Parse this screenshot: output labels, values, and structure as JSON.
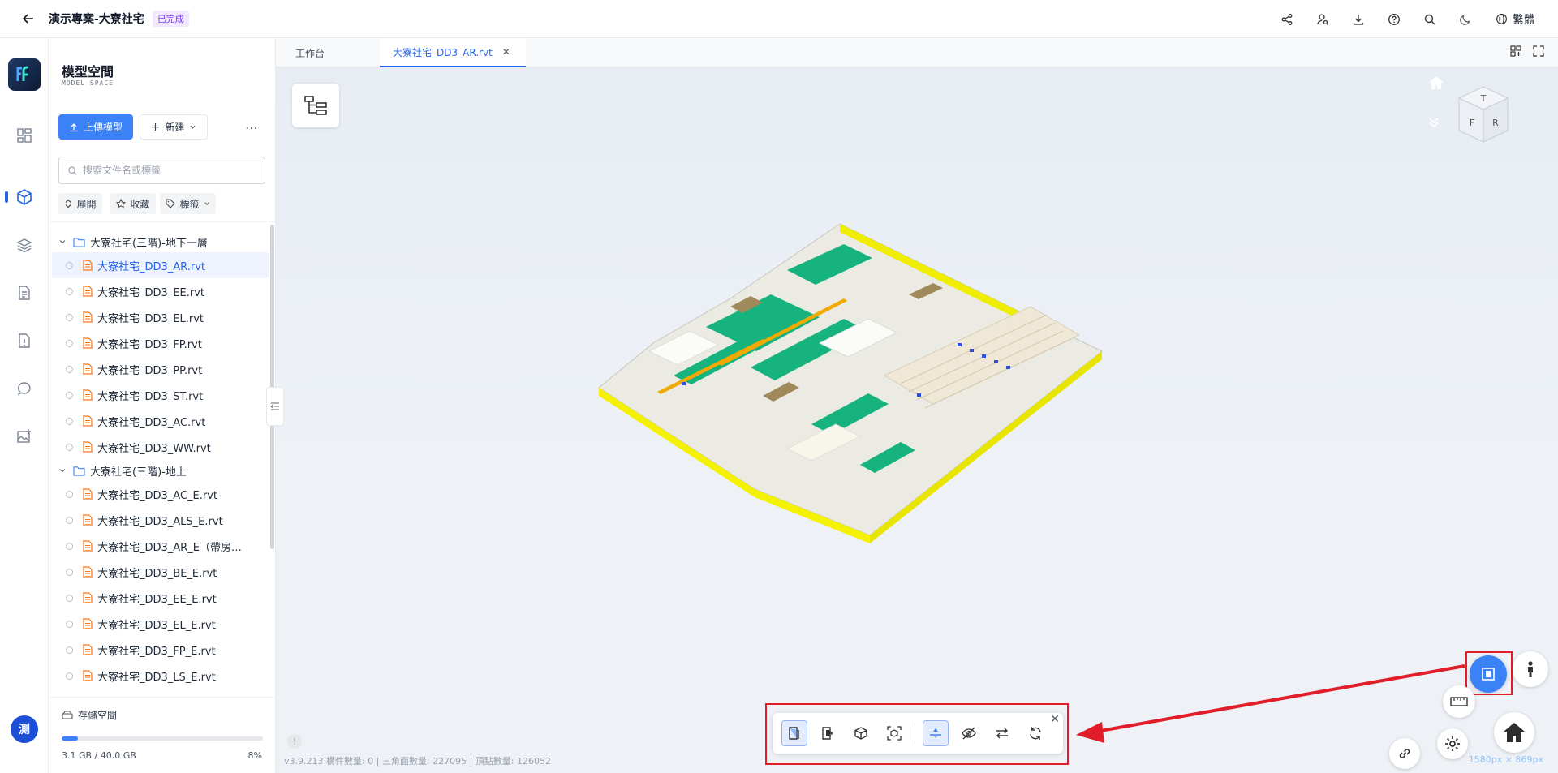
{
  "header": {
    "project_title": "演示專案-大寮社宅",
    "status": "已完成",
    "language": "繁體"
  },
  "sidebar": {
    "title": "模型空間",
    "subtitle": "MODEL SPACE",
    "upload_label": "上傳模型",
    "new_label": "新建",
    "search_placeholder": "搜索文件名或標籤",
    "filters": {
      "expand": "展開",
      "favorite": "收藏",
      "tag": "標籤"
    },
    "folders": [
      {
        "name": "大寮社宅(三階)-地下一層",
        "files": [
          "大寮社宅_DD3_AR.rvt",
          "大寮社宅_DD3_EE.rvt",
          "大寮社宅_DD3_EL.rvt",
          "大寮社宅_DD3_FP.rvt",
          "大寮社宅_DD3_PP.rvt",
          "大寮社宅_DD3_ST.rvt",
          "大寮社宅_DD3_AC.rvt",
          "大寮社宅_DD3_WW.rvt"
        ]
      },
      {
        "name": "大寮社宅(三階)-地上",
        "files": [
          "大寮社宅_DD3_AC_E.rvt",
          "大寮社宅_DD3_ALS_E.rvt",
          "大寮社宅_DD3_AR_E（帶房…",
          "大寮社宅_DD3_BE_E.rvt",
          "大寮社宅_DD3_EE_E.rvt",
          "大寮社宅_DD3_EL_E.rvt",
          "大寮社宅_DD3_FP_E.rvt",
          "大寮社宅_DD3_LS_E.rvt"
        ]
      }
    ],
    "storage": {
      "label": "存儲空間",
      "used": "3.1 GB / 40.0 GB",
      "percent_text": "8%",
      "fraction": 0.08
    },
    "user_initial": "測"
  },
  "tabs": [
    {
      "label": "工作台"
    },
    {
      "label": "大寮社宅_DD3_AR.rvt"
    }
  ],
  "viewport": {
    "view_cube_faces": {
      "top": "T",
      "front": "F",
      "right": "R"
    },
    "status_line": "v3.9.213   構件數量: 0 | 三角面數量: 227095 | 頂點數量: 126052",
    "resolution": "1580px × 869px"
  },
  "colors": {
    "accent": "#3b82f6",
    "highlight": "#e11d2a",
    "status_badge": "#7c3aed",
    "model_green": "#16b37e",
    "model_yellow": "#f5f500"
  }
}
